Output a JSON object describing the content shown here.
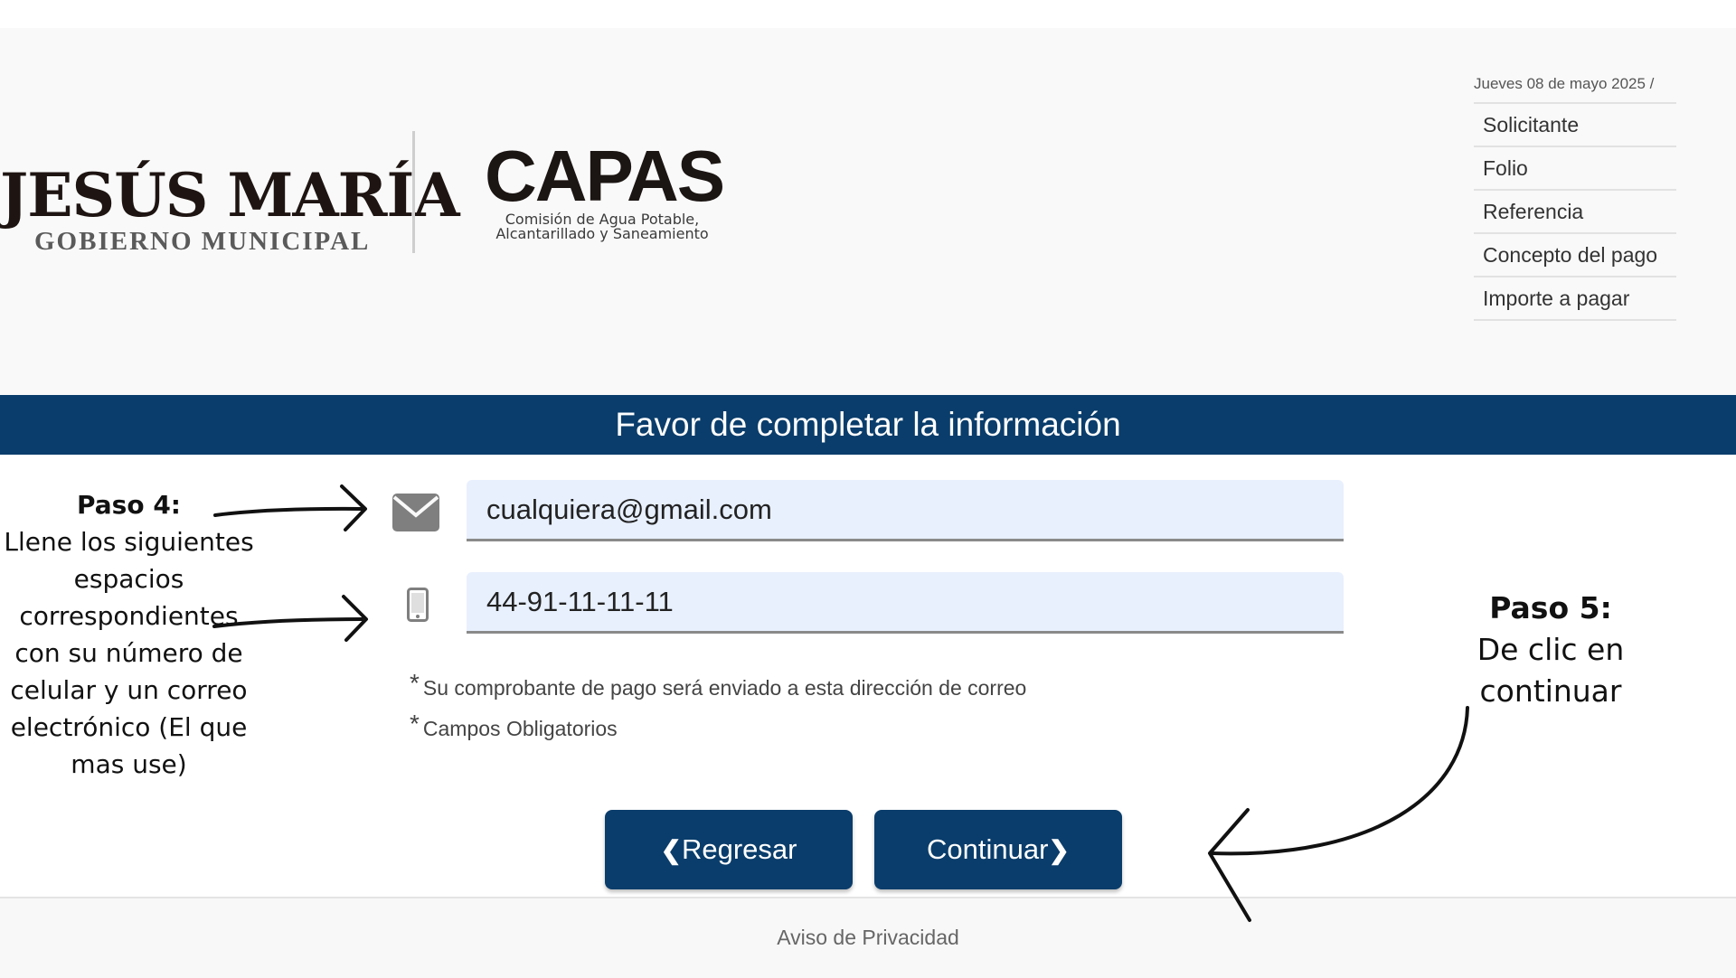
{
  "header": {
    "logo_jesus_maria": {
      "main": "JESÚS MARÍA",
      "sub": "GOBIERNO MUNICIPAL"
    },
    "logo_capas": {
      "main": "CAPAS",
      "sub_line1": "Comisión de Agua Potable,",
      "sub_line2": "Alcantarillado y Saneamiento"
    }
  },
  "summary": {
    "date": "Jueves 08 de mayo 2025 /",
    "items": [
      {
        "label": "Solicitante"
      },
      {
        "label": "Folio"
      },
      {
        "label": "Referencia"
      },
      {
        "label": "Concepto del pago"
      },
      {
        "label": "Importe a pagar"
      }
    ]
  },
  "form": {
    "title": "Favor de completar la información",
    "email": {
      "value": "cualquiera@gmail.com",
      "icon": "envelope-icon"
    },
    "phone": {
      "value": "44-91-11-11-11",
      "icon": "mobile-phone-icon"
    },
    "note_email": "Su comprobante de pago será enviado a esta dirección de correo",
    "note_required": "Campos Obligatorios",
    "note_star": "*",
    "back_label": "Regresar",
    "continue_label": "Continuar",
    "back_chevron": "❮",
    "continue_chevron": "❯"
  },
  "footer": {
    "privacy": "Aviso de Privacidad"
  },
  "annotations": {
    "step4_title": "Paso 4:",
    "step4_text": "Llene los siguientes espacios correspondientes con su número de celular y un correo electrónico (El que mas use)",
    "step5_title": "Paso 5:",
    "step5_text": "De clic en continuar"
  },
  "colors": {
    "brand_blue": "#0a3d6b",
    "input_bg": "#e8f0fe",
    "header_bg": "#f9f9f9"
  }
}
